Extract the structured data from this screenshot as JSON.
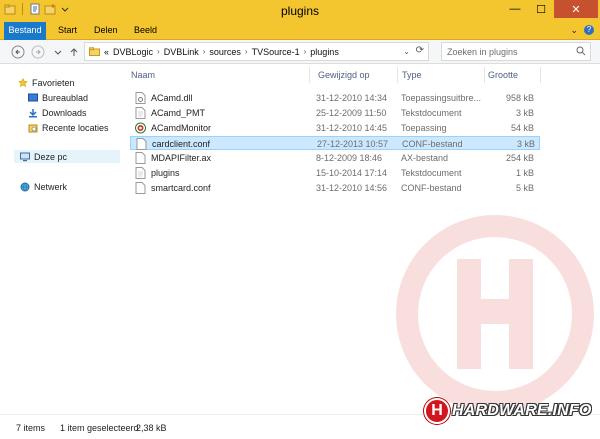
{
  "window": {
    "title": "plugins",
    "controls": {
      "minimize": "—",
      "maximize": "☐",
      "close": "✕"
    }
  },
  "ribbon": {
    "tabs": [
      "Bestand",
      "Start",
      "Delen",
      "Beeld"
    ],
    "help": "?"
  },
  "address": {
    "prefix": "«",
    "crumbs": [
      "DVBLogic",
      "DVBLink",
      "sources",
      "TVSource-1",
      "plugins"
    ]
  },
  "search": {
    "placeholder": "Zoeken in plugins"
  },
  "navpane": {
    "favorites": "Favorieten",
    "favorite_items": [
      "Bureaublad",
      "Downloads",
      "Recente locaties"
    ],
    "this_pc": "Deze pc",
    "network": "Netwerk"
  },
  "columns": {
    "name": "Naam",
    "date": "Gewijzigd op",
    "type": "Type",
    "size": "Grootte"
  },
  "files": [
    {
      "name": "ACamd.dll",
      "date": "31-12-2010 14:34",
      "type": "Toepassingsuitbre...",
      "size": "958 kB",
      "icon": "dll-icon"
    },
    {
      "name": "ACamd_PMT",
      "date": "25-12-2009 11:50",
      "type": "Tekstdocument",
      "size": "3 kB",
      "icon": "text-file-icon"
    },
    {
      "name": "ACamdMonitor",
      "date": "31-12-2010 14:45",
      "type": "Toepassing",
      "size": "54 kB",
      "icon": "app-icon"
    },
    {
      "name": "cardclient.conf",
      "date": "27-12-2013 10:57",
      "type": "CONF-bestand",
      "size": "3 kB",
      "icon": "file-icon",
      "selected": true
    },
    {
      "name": "MDAPIFilter.ax",
      "date": "8-12-2009 18:46",
      "type": "AX-bestand",
      "size": "254 kB",
      "icon": "file-icon"
    },
    {
      "name": "plugins",
      "date": "15-10-2014 17:14",
      "type": "Tekstdocument",
      "size": "1 kB",
      "icon": "text-file-icon"
    },
    {
      "name": "smartcard.conf",
      "date": "31-12-2010 14:56",
      "type": "CONF-bestand",
      "size": "5 kB",
      "icon": "file-icon"
    }
  ],
  "status": {
    "count": "7 items",
    "selection": "1 item geselecteerd",
    "size": "2,38 kB"
  },
  "brand": {
    "letter": "H",
    "text": "HARDWARE.INFO"
  }
}
